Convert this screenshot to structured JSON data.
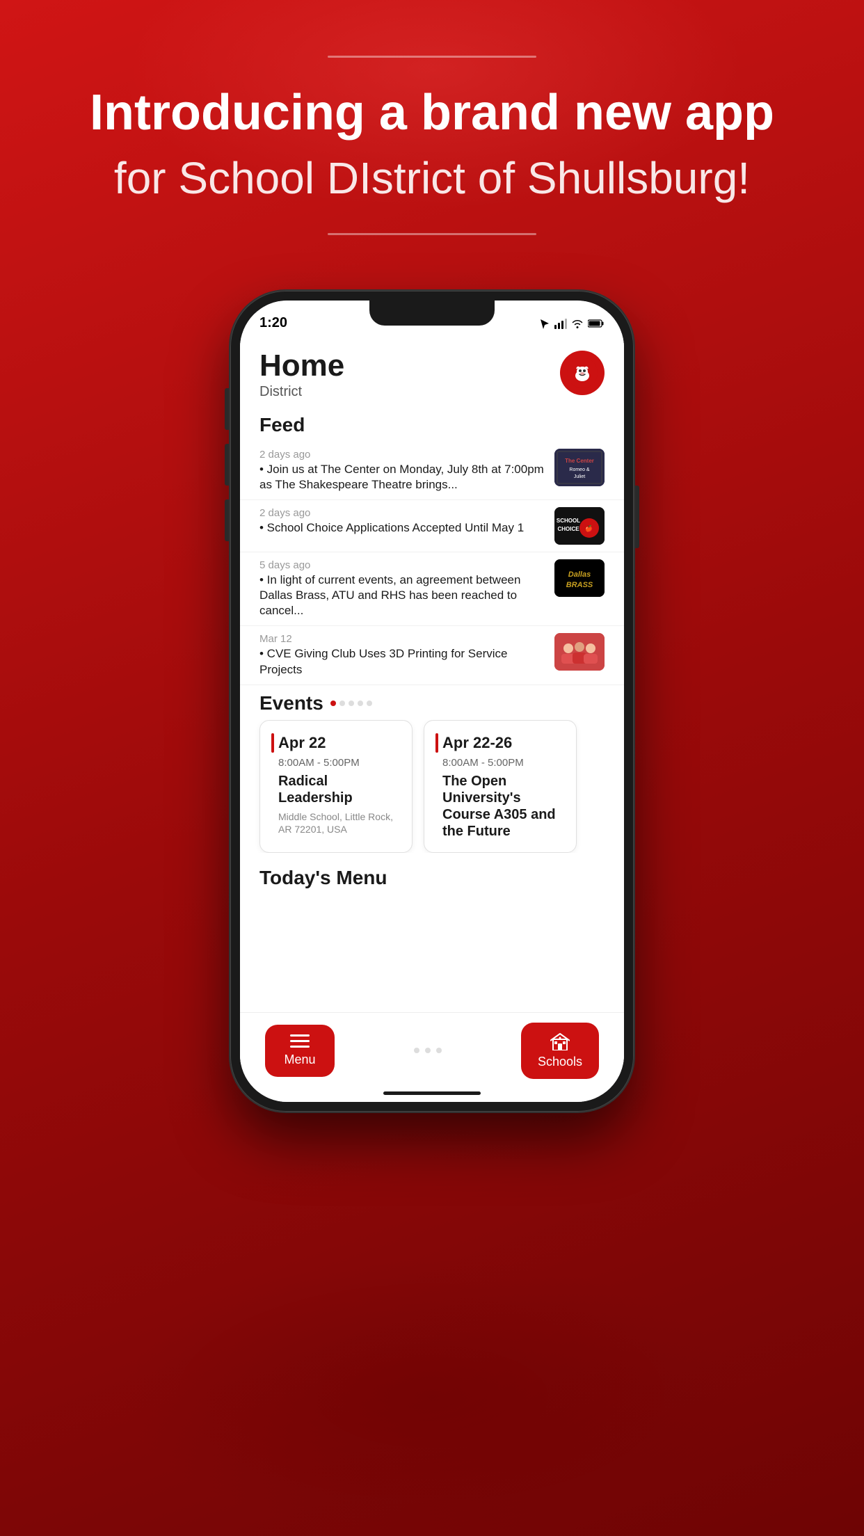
{
  "page": {
    "background": "#cc1111"
  },
  "header": {
    "divider_top": true,
    "title_bold": "Introducing a brand new app",
    "title_regular": "for School DIstrict of Shullsburg!",
    "divider_bottom": true
  },
  "phone": {
    "status_bar": {
      "time": "1:20",
      "arrow_icon": "location-arrow-icon",
      "signal_icon": "signal-icon",
      "wifi_icon": "wifi-icon",
      "battery_icon": "battery-icon"
    },
    "app": {
      "home_title": "Home",
      "home_subtitle": "District",
      "feed_section_label": "Feed",
      "feed_items": [
        {
          "timestamp": "2 days ago",
          "text": "• Join us at The Center on Monday, July 8th at 7:00pm as The Shakespeare Theatre brings...",
          "thumbnail_type": "theatre"
        },
        {
          "timestamp": "2 days ago",
          "text": "• School Choice Applications Accepted Until May 1",
          "thumbnail_type": "school_choice"
        },
        {
          "timestamp": "5 days ago",
          "text": "• In light of current events, an agreement between Dallas Brass, ATU and RHS has been reached to cancel...",
          "thumbnail_type": "dallas_brass"
        },
        {
          "timestamp": "Mar 12",
          "text": "• CVE Giving Club Uses 3D Printing for Service Projects",
          "thumbnail_type": "cve"
        }
      ],
      "events_section_label": "Events",
      "events": [
        {
          "date": "Apr 22",
          "time": "8:00AM - 5:00PM",
          "name": "Radical Leadership",
          "location": "Middle School, Little Rock, AR 72201, USA"
        },
        {
          "date": "Apr 22-26",
          "time": "8:00AM - 5:00PM",
          "name": "The Open University's Course A305 and the Future",
          "location": ""
        }
      ],
      "todays_menu_label": "Today's Menu",
      "nav": {
        "menu_label": "Menu",
        "schools_label": "Schools",
        "menu_icon": "menu-icon",
        "schools_icon": "schools-icon"
      }
    }
  }
}
